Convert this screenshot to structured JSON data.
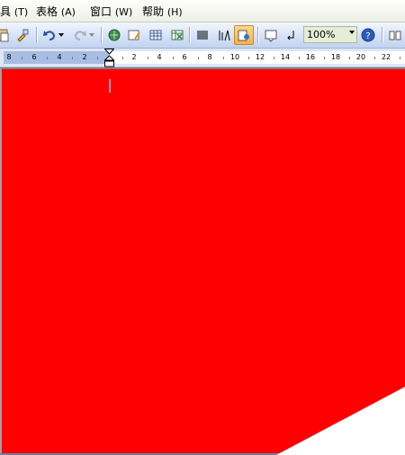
{
  "menubar": {
    "items": [
      {
        "label": "具",
        "acc": "(T)"
      },
      {
        "label": "表格",
        "acc": "(A)"
      },
      {
        "label": "窗口",
        "acc": "(W)"
      },
      {
        "label": "帮助",
        "acc": "(H)"
      }
    ]
  },
  "toolbar": {
    "zoom": "100%"
  },
  "ruler": {
    "left_labels": [
      "8",
      "6",
      "4",
      "2"
    ],
    "right_labels": [
      "2",
      "4",
      "6",
      "8",
      "10",
      "12",
      "14",
      "16",
      "18",
      "20",
      "22"
    ]
  },
  "document": {
    "background_color": "#ff0000"
  }
}
